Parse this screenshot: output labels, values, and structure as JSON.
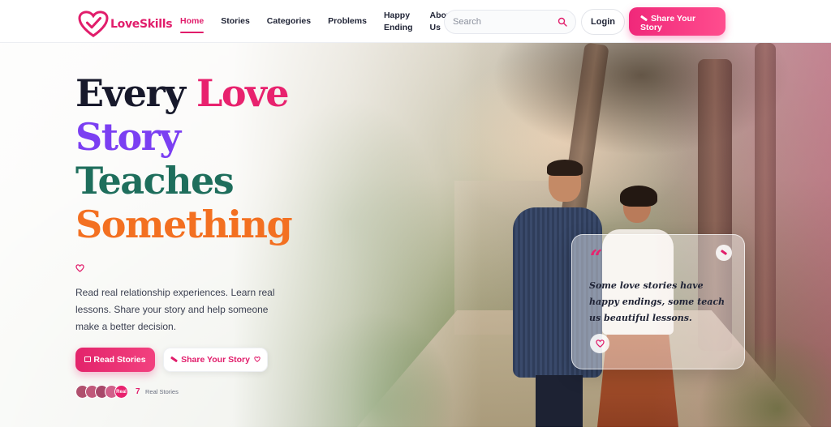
{
  "brand": {
    "name": "LoveSkills",
    "color": "#e11d6b"
  },
  "nav": {
    "items": [
      {
        "label": "Home",
        "active": true
      },
      {
        "label": "Stories",
        "active": false
      },
      {
        "label": "Categories",
        "active": false
      },
      {
        "label": "Problems",
        "active": false
      },
      {
        "label_line1": "Happy",
        "label_line2": "Ending",
        "active": false
      },
      {
        "label_line1": "About",
        "label_line2": "Us",
        "active": false
      }
    ],
    "search_placeholder": "Search",
    "login_label": "Login",
    "share_label_line1": "Share Your",
    "share_label_line2": "Story"
  },
  "hero": {
    "headline": {
      "line1_dark": "Every",
      "line1_accent": "Love",
      "line2": "Story",
      "line3": "Teaches",
      "line4": "Something"
    },
    "subtitle": "Read real relationship experiences. Learn real lessons. Share your story and help someone make a better decision.",
    "read_button": "Read Stories",
    "share_button": "Share Your Story",
    "stories_count": "7",
    "stories_label": "Real Stories",
    "avatar_badge": "Real"
  },
  "quote_card": {
    "mark": "“",
    "text": "Some love stories have happy endings, some teach us beautiful lessons."
  },
  "colors": {
    "accent_pink": "#e8226e",
    "purple": "#7b3ff2",
    "green": "#1e6e5c",
    "orange": "#f37021",
    "dark": "#17192b"
  },
  "icons": [
    "heart-logo-icon",
    "search-icon",
    "pencil-icon",
    "heart-icon",
    "book-icon",
    "quote-icon"
  ]
}
